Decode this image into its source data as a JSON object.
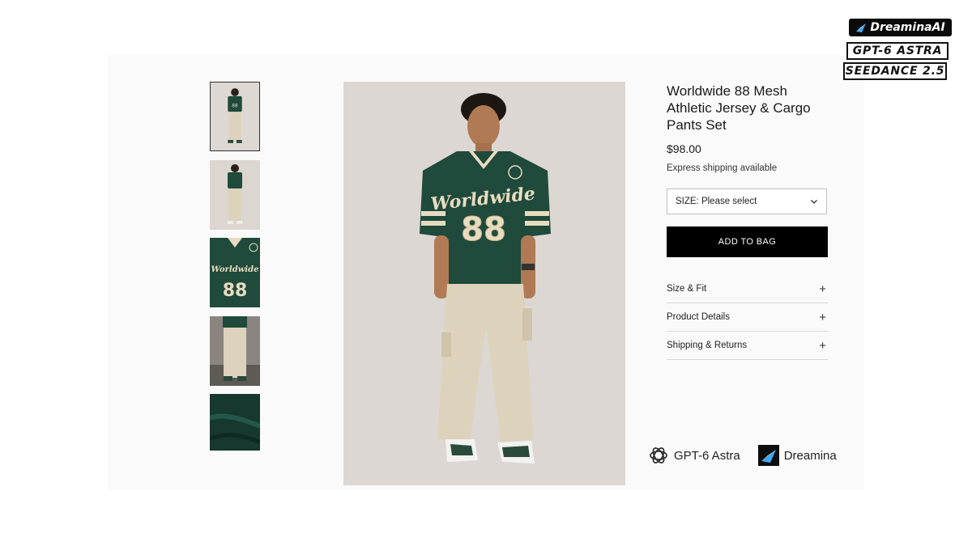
{
  "product": {
    "title_lines": [
      "Worldwide 88 Mesh",
      "Athletic Jersey & Cargo",
      "Pants Set"
    ],
    "price": "$98.00",
    "shipping_note": "Express shipping available",
    "size_select": {
      "value": "SIZE: Please select",
      "icon": "chevron-down-icon"
    },
    "add_to_bag": "ADD TO BAG",
    "accordion": [
      {
        "label": "Size & Fit",
        "icon": "plus-icon"
      },
      {
        "label": "Product Details",
        "icon": "plus-icon"
      },
      {
        "label": "Shipping & Returns",
        "icon": "plus-icon"
      }
    ]
  },
  "gallery": {
    "thumbnails": [
      "full-body-front",
      "full-body-back",
      "jersey-closeup",
      "pants-closeup",
      "fabric-closeup"
    ],
    "active_index": 0,
    "jersey_text": "Worldwide",
    "jersey_number": "88"
  },
  "branding": {
    "items": [
      {
        "label": "GPT-6 Astra",
        "icon": "openai-logo-icon"
      },
      {
        "label": "Dreamina",
        "icon": "dreamina-logo-icon"
      }
    ]
  },
  "badges": [
    "DreaminaAI",
    "GPT-6 ASTRA",
    "SEEDANCE 2.5"
  ],
  "colors": {
    "jersey_green": "#1f4a3c",
    "jersey_cream": "#e8dcc0",
    "pants_khaki": "#ddd2bb",
    "button_black": "#000000",
    "studio_bg": "#dcd7d3"
  }
}
